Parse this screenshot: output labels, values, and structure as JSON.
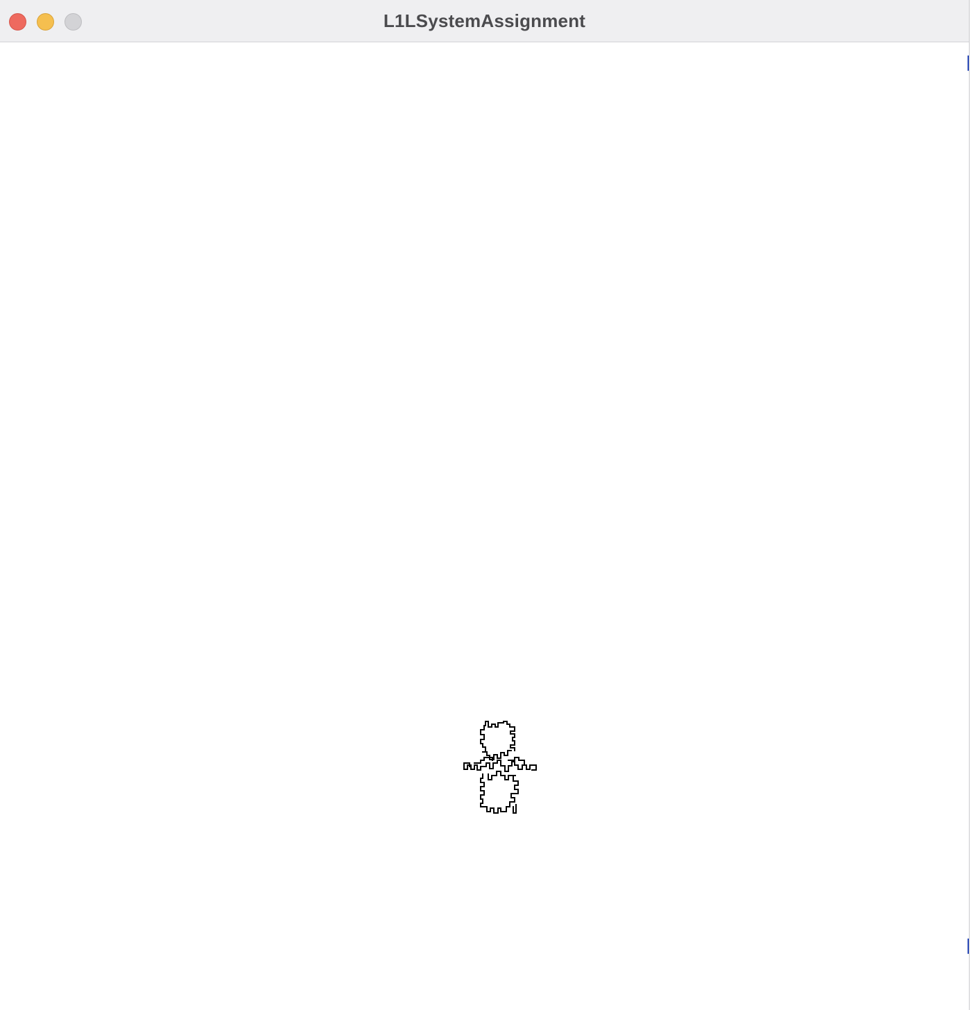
{
  "window": {
    "title": "L1LSystemAssignment"
  },
  "controls": {
    "close_icon": "close-icon",
    "minimize_icon": "minimize-icon",
    "zoom_icon": "zoom-icon"
  },
  "colors": {
    "titlebar": "#efeff1",
    "title_text": "#4b4b4e",
    "close": "#ee6a5f",
    "minimize": "#f5bf4f",
    "zoom_disabled": "#d3d3d6",
    "canvas": "#ffffff",
    "stroke": "#000000",
    "edge_accent": "#2a49b8"
  }
}
